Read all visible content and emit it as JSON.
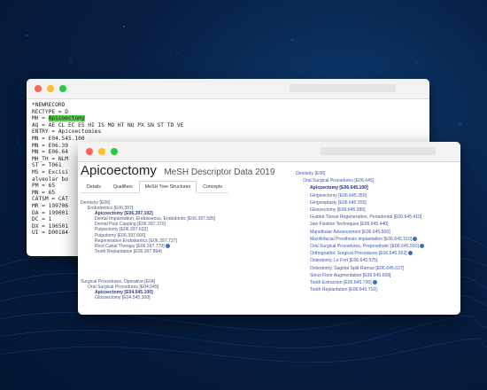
{
  "record": {
    "lines": [
      {
        "key": "*NEWRECORD",
        "value": ""
      },
      {
        "key": "RECTYPE = ",
        "value": "D"
      },
      {
        "key": "MH = ",
        "value": "",
        "highlight": "Apicoectomy"
      },
      {
        "key": "AQ = ",
        "value": "AE CL EC ES HI IS MO HT NU PX SN ST TD VE"
      },
      {
        "key": "ENTRY = ",
        "value": "Apicoectomies"
      },
      {
        "key": "MN = ",
        "value": "E04.545.100"
      },
      {
        "key": "MN = ",
        "value": "E06.39"
      },
      {
        "key": "MN = ",
        "value": "E06.64"
      },
      {
        "key": "MH_TH = ",
        "value": "NLM"
      },
      {
        "key": "ST = ",
        "value": "T061"
      },
      {
        "key": "MS = ",
        "value": "Excisi"
      },
      {
        "key": "alveolar bo",
        "value": ""
      },
      {
        "key": "PM = ",
        "value": "65"
      },
      {
        "key": "MN = ",
        "value": "65"
      },
      {
        "key": "CATSM = ",
        "value": "CAT"
      },
      {
        "key": "MR = ",
        "value": "199706"
      },
      {
        "key": "DA = ",
        "value": "199001"
      },
      {
        "key": "DC = ",
        "value": "1"
      },
      {
        "key": "DX = ",
        "value": "196501"
      },
      {
        "key": "UI = ",
        "value": "D00184"
      }
    ]
  },
  "descriptor": {
    "term": "Apicoectomy",
    "subtitle": "MeSH Descriptor Data 2019",
    "tabs": [
      "Details",
      "Qualifiers",
      "MeSH Tree Structures",
      "Concepts"
    ],
    "active_tab": "MeSH Tree Structures"
  },
  "tree_left": [
    {
      "label": "Dentistry [E06]",
      "level": 1,
      "bold": false
    },
    {
      "label": "Endodontics [E06.397]",
      "level": 2,
      "bold": false
    },
    {
      "label": "Apicoectomy [E06.397.102]",
      "level": 3,
      "bold": true
    },
    {
      "label": "Dental Implantation, Endosseous, Endodontic [E06.397.585]",
      "level": 3,
      "bold": false
    },
    {
      "label": "Dental Pulp Capping [E06.397.370]",
      "level": 3,
      "bold": false
    },
    {
      "label": "Pulpectomy [E06.397.633]",
      "level": 3,
      "bold": false
    },
    {
      "label": "Pulpotomy [E06.397.666]",
      "level": 3,
      "bold": false
    },
    {
      "label": "Regenerative Endodontics [E06.397.737]",
      "level": 3,
      "bold": false
    },
    {
      "label": "Root Canal Therapy [E06.397.779]",
      "level": 3,
      "bold": false,
      "info": true
    },
    {
      "label": "Tooth Replantation [E06.397.894]",
      "level": 3,
      "bold": false
    }
  ],
  "tree_left2": [
    {
      "label": "Surgical Procedures, Operative [E04]",
      "level": 1,
      "bold": false
    },
    {
      "label": "Oral Surgical Procedures [E04.545]",
      "level": 2,
      "bold": false
    },
    {
      "label": "Apicoectomy [E04.545.100]",
      "level": 3,
      "bold": true
    },
    {
      "label": "Glossectomy [E04.545.300]",
      "level": 3,
      "bold": false
    }
  ],
  "tree_right": [
    {
      "label": "Dentistry [E06]",
      "level": 1,
      "bold": false
    },
    {
      "label": "Oral Surgical Procedures [E06.645]",
      "level": 2,
      "bold": false
    },
    {
      "label": "Apicoectomy [E06.645.100]",
      "level": 3,
      "bold": true
    },
    {
      "label": "Gingivectomy [E06.645.350]",
      "level": 3,
      "bold": false
    },
    {
      "label": "Gingivoplasty [E06.645.355]",
      "level": 3,
      "bold": false
    },
    {
      "label": "Glossectomy [E06.645.380]",
      "level": 3,
      "bold": false
    },
    {
      "label": "Guided Tissue Regeneration, Periodontal [E06.645.410]",
      "level": 3,
      "bold": false
    },
    {
      "label": "Jaw Fixation Techniques [E06.645.440]",
      "level": 3,
      "bold": false
    },
    {
      "label": "Mandibular Advancement [E06.645.500]",
      "level": 3,
      "bold": false
    },
    {
      "label": "Maxillofacial Prosthesis Implantation [E06.645.510]",
      "level": 3,
      "bold": false,
      "info": true
    },
    {
      "label": "Oral Surgical Procedures, Preprosthetic [E06.645.550]",
      "level": 3,
      "bold": false,
      "info": true
    },
    {
      "label": "Orthognathic Surgical Procedures [E06.645.562]",
      "level": 3,
      "bold": false,
      "info": true
    },
    {
      "label": "Osteotomy, Le Fort [E06.645.575]",
      "level": 3,
      "bold": false
    },
    {
      "label": "Osteotomy, Sagittal Split Ramus [E06.645.637]",
      "level": 3,
      "bold": false
    },
    {
      "label": "Sinus Floor Augmentation [E06.645.668]",
      "level": 3,
      "bold": false
    },
    {
      "label": "Tooth Extraction [E06.645.700]",
      "level": 3,
      "bold": false,
      "info": true
    },
    {
      "label": "Tooth Replantation [E06.645.710]",
      "level": 3,
      "bold": false
    }
  ],
  "colors": {
    "background": "#071f44",
    "highlight": "#57c84d",
    "link": "#3d5aa8",
    "link_bold": "#1e2f7a"
  }
}
